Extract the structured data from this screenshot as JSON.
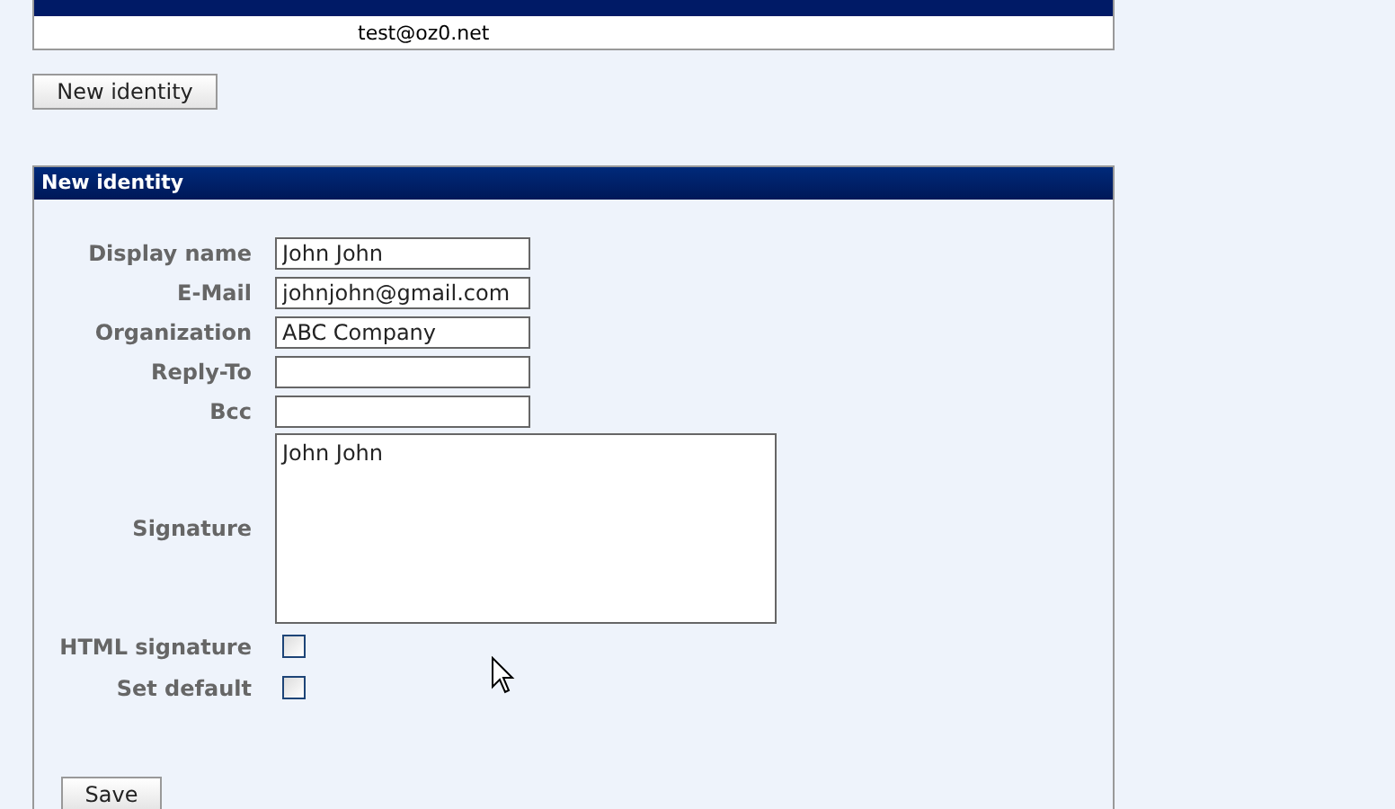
{
  "identities_table": {
    "rows": [
      [
        "",
        "test@oz0.net",
        "",
        ""
      ]
    ]
  },
  "new_identity_button": "New identity",
  "panel": {
    "title": "New identity",
    "fields": [
      {
        "kind": "text",
        "label": "Display name",
        "value": "John John"
      },
      {
        "kind": "text",
        "label": "E-Mail",
        "value": "johnjohn@gmail.com"
      },
      {
        "kind": "text",
        "label": "Organization",
        "value": "ABC Company"
      },
      {
        "kind": "text",
        "label": "Reply-To"
      },
      {
        "kind": "text",
        "label": "Bcc"
      },
      {
        "kind": "textarea",
        "label": "Signature",
        "value": "John John"
      },
      {
        "kind": "checkbox",
        "label": "HTML signature",
        "checked": false
      },
      {
        "kind": "checkbox",
        "label": "Set default",
        "checked": false
      }
    ],
    "save_button": "Save"
  }
}
